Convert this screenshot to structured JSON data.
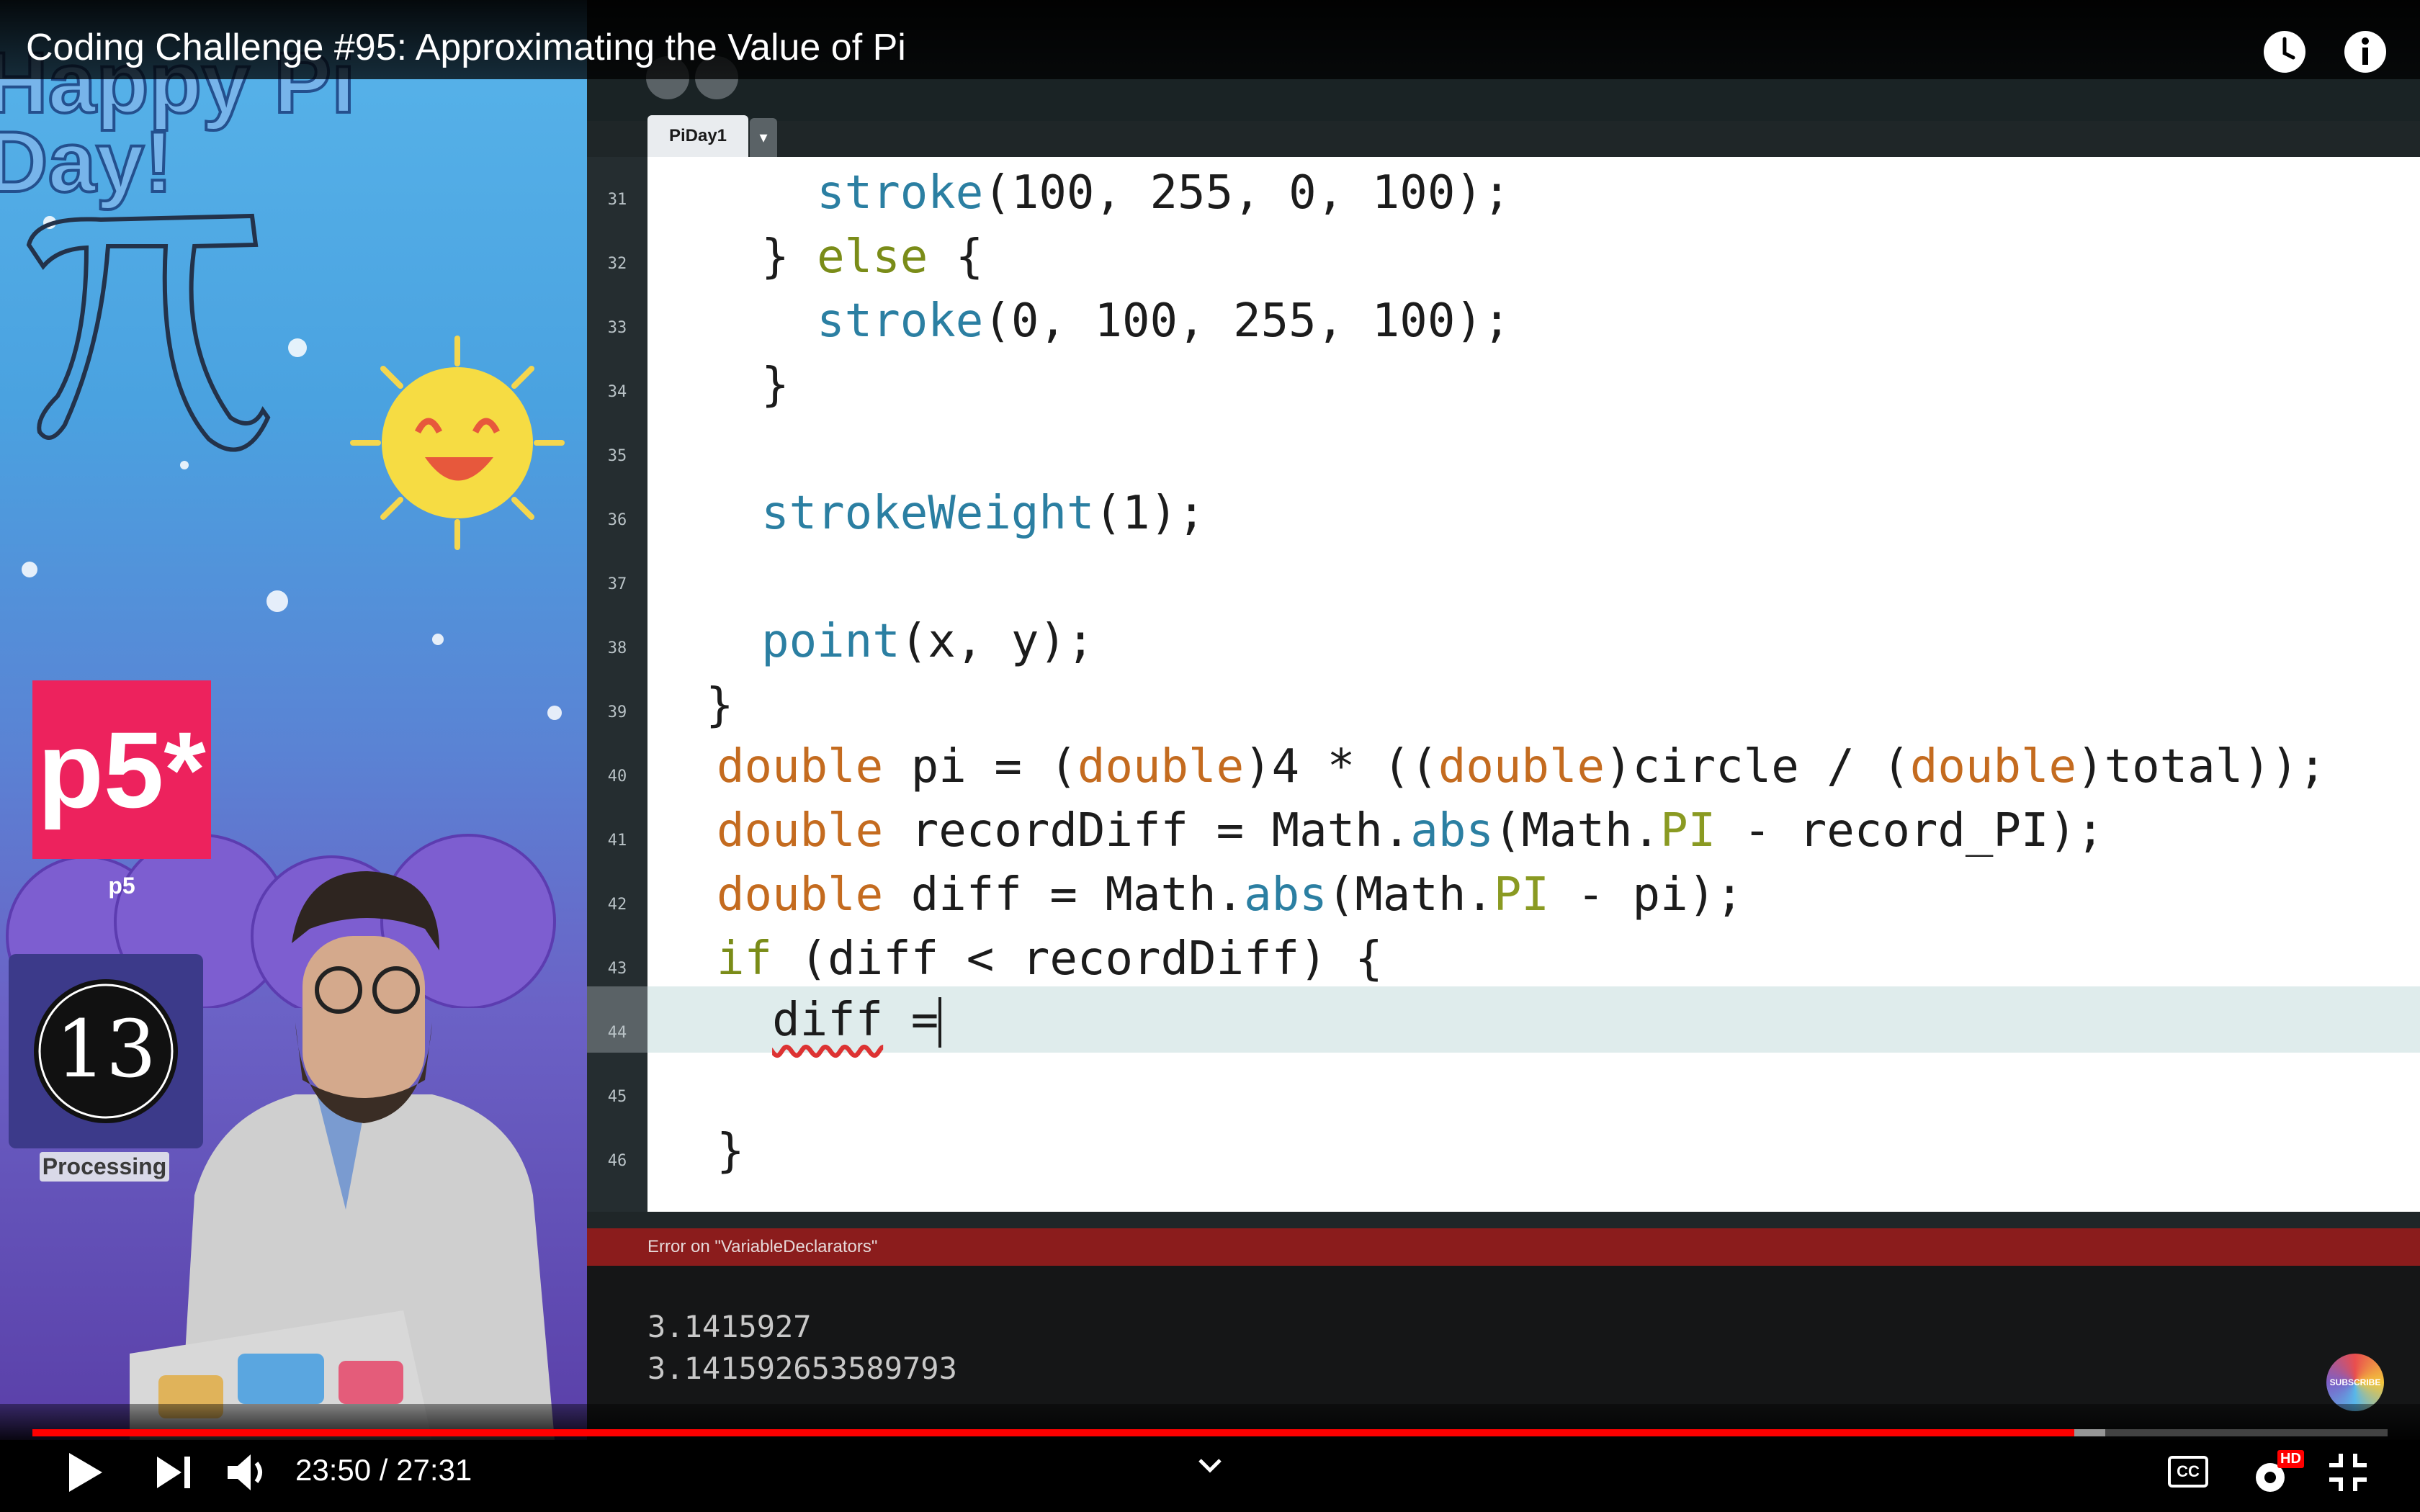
{
  "video": {
    "title": "Coding Challenge #95: Approximating the Value of Pi",
    "current_time": "23:50",
    "duration": "27:31",
    "time_display": "23:50 / 27:31",
    "progress_fraction": 0.867,
    "buffered_fraction": 0.88
  },
  "overlay": {
    "pi_day_text": "Happy Pi Day!",
    "p5_label": "p5*",
    "p5_caption": "p5",
    "processing_caption": "Processing",
    "subscribe_label": "SUBSCRIBE"
  },
  "ide": {
    "tab_name": "PiDay1",
    "tab_menu_icon": "triangle-down",
    "line_numbers": [
      "31",
      "32",
      "33",
      "34",
      "35",
      "36",
      "37",
      "38",
      "39",
      "40",
      "41",
      "42",
      "43",
      "44",
      "45",
      "46"
    ],
    "error_message": "Error on \"VariableDeclarators\"",
    "console": [
      "3.1415927",
      "3.141592653589793"
    ]
  },
  "controls": {
    "hd_label": "HD",
    "cc_label": "CC"
  },
  "colors": {
    "progress_played": "#ff0000",
    "error_bar": "#8b1c1c",
    "p5_pink": "#ed225d"
  }
}
